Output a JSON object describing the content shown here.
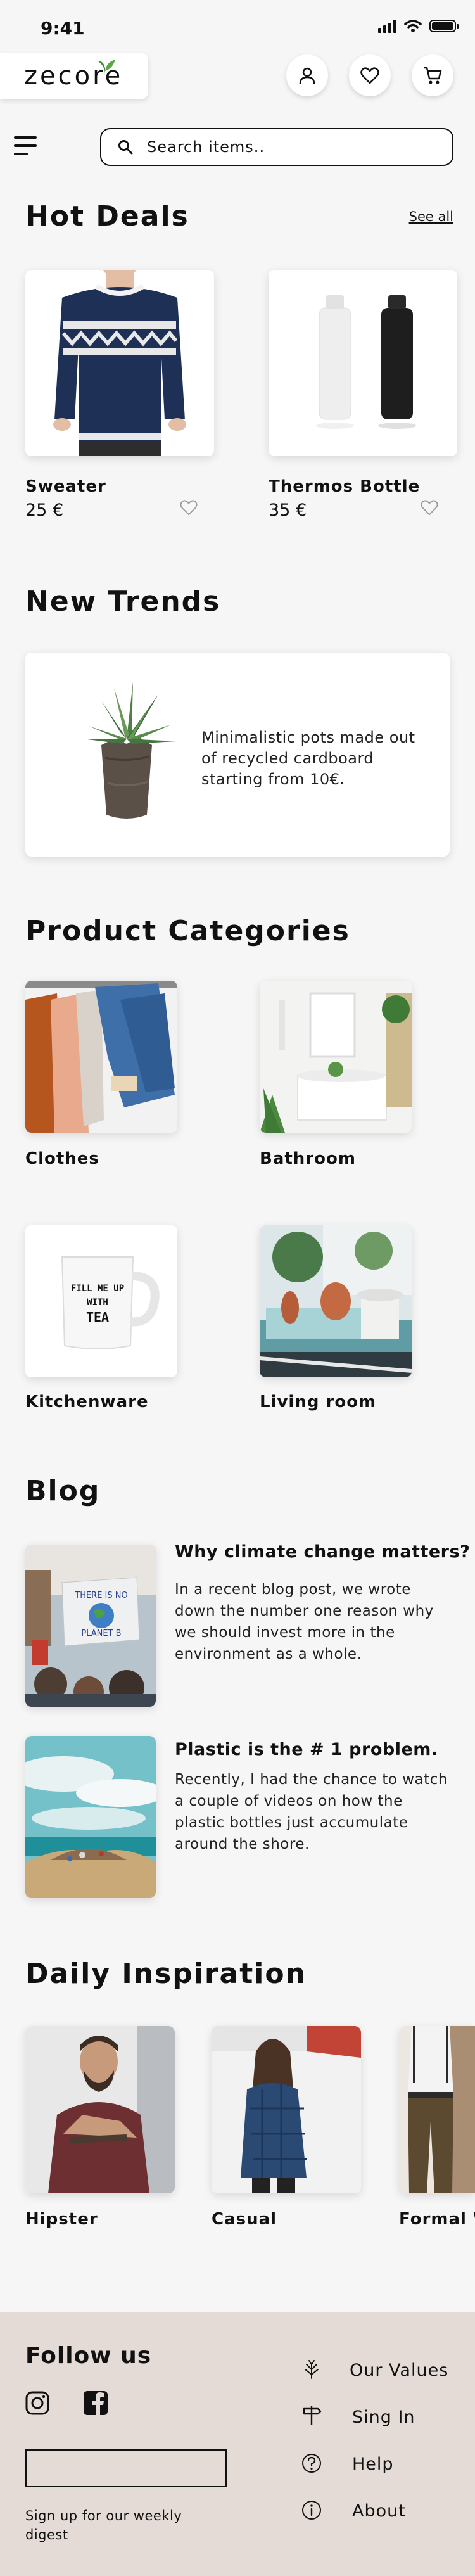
{
  "status": {
    "time": "9:41"
  },
  "brand": {
    "logo": "zecore"
  },
  "header": {
    "icons": [
      "user-icon",
      "heart-icon",
      "cart-icon"
    ]
  },
  "search": {
    "placeholder": "Search items.."
  },
  "hot_deals": {
    "title": "Hot Deals",
    "see_all": "See all",
    "items": [
      {
        "name": "Sweater",
        "price": "25 €"
      },
      {
        "name": "Thermos Bottle",
        "price": "35 €"
      }
    ]
  },
  "new_trends": {
    "title": "New Trends",
    "text": "Minimalistic pots made out of recycled cardboard starting from 10€."
  },
  "categories": {
    "title": "Product Categories",
    "items": [
      "Clothes",
      "Bathroom",
      "Kitchenware",
      "Living room"
    ]
  },
  "mug_text": [
    "FILL ME UP",
    "WITH",
    "TEA"
  ],
  "blog": {
    "title": "Blog",
    "posts": [
      {
        "title": "Why climate change matters?",
        "body": "In a recent blog post, we wrote down the number one reason why we should invest more in the environment as a whole.",
        "sign_text": [
          "THERE IS NO",
          "PLANET B"
        ]
      },
      {
        "title": "Plastic is the # 1 problem.",
        "body": "Recently, I had the chance to watch a couple of videos on how the plastic bottles just accumulate around the shore."
      }
    ]
  },
  "inspiration": {
    "title": "Daily Inspiration",
    "items": [
      "Hipster",
      "Casual",
      "Formal W"
    ]
  },
  "footer": {
    "follow": "Follow us",
    "social": [
      "instagram-icon",
      "facebook-icon"
    ],
    "newsletter_label": "Sign up for our weekly digest",
    "links": [
      "Our Values",
      "Sing In",
      "Help",
      "About"
    ]
  },
  "colors": {
    "background": "#f6f6f6",
    "footer": "#e4dbd7",
    "text": "#111111"
  }
}
